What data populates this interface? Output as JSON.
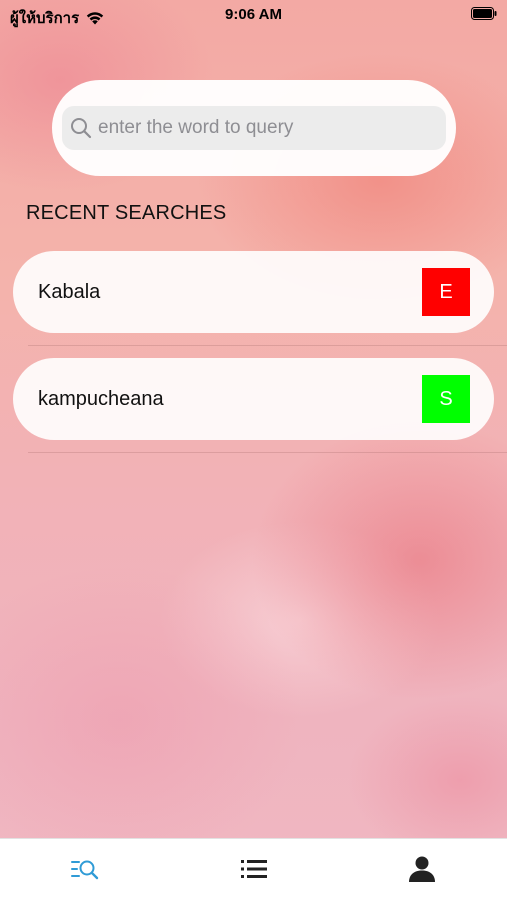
{
  "status_bar": {
    "carrier": "ผู้ให้บริการ",
    "time": "9:06 AM"
  },
  "search": {
    "placeholder": "enter the word to query",
    "value": ""
  },
  "recent": {
    "title": "RECENT SEARCHES",
    "items": [
      {
        "word": "Kabala",
        "badge": "E",
        "badge_color": "#ff0000"
      },
      {
        "word": "kampucheana",
        "badge": "S",
        "badge_color": "#00ff00"
      }
    ]
  },
  "tab_bar": {
    "tabs": [
      {
        "icon": "search-list-icon",
        "active": true,
        "color": "#2f9bd6"
      },
      {
        "icon": "list-icon",
        "active": false,
        "color": "#222222"
      },
      {
        "icon": "person-icon",
        "active": false,
        "color": "#222222"
      }
    ]
  }
}
